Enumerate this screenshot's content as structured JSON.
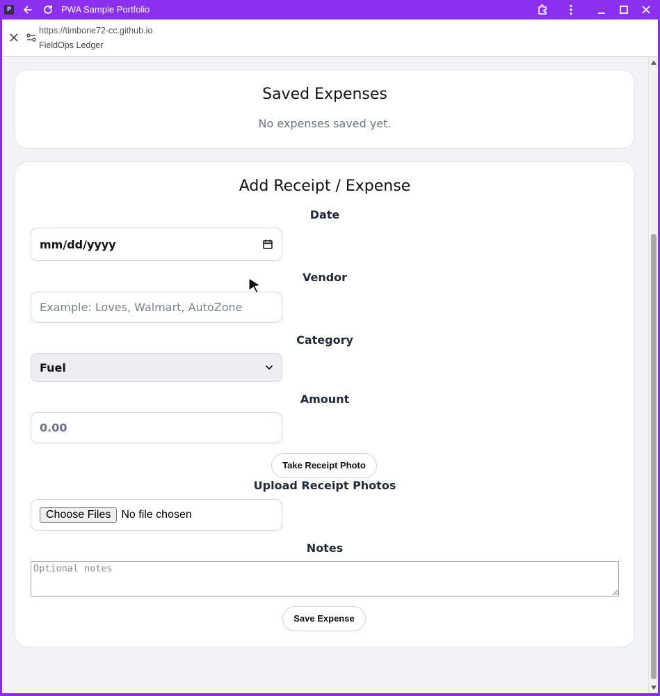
{
  "window": {
    "title": "PWA Sample Portfolio",
    "accent": "#8b2ff0"
  },
  "urlbar": {
    "url": "https://timbone72-cc.github.io",
    "site_name": "FieldOps Ledger"
  },
  "saved": {
    "heading": "Saved Expenses",
    "empty_message": "No expenses saved yet."
  },
  "form": {
    "heading": "Add Receipt / Expense",
    "date": {
      "label": "Date",
      "value": "mm/dd/yyyy"
    },
    "vendor": {
      "label": "Vendor",
      "placeholder": "Example: Loves, Walmart, AutoZone"
    },
    "category": {
      "label": "Category",
      "selected": "Fuel"
    },
    "amount": {
      "label": "Amount",
      "placeholder": "0.00"
    },
    "take_photo_label": "Take Receipt Photo",
    "upload": {
      "label": "Upload Receipt Photos",
      "button": "Choose Files",
      "status": "No file chosen"
    },
    "notes": {
      "label": "Notes",
      "placeholder": "Optional notes"
    },
    "save_label": "Save Expense"
  }
}
